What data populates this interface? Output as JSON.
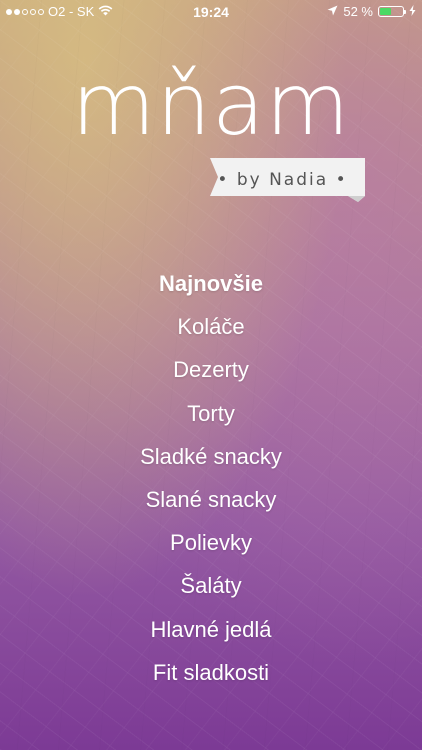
{
  "status_bar": {
    "carrier": "O2 - SK",
    "time": "19:24",
    "battery_percent": "52 %",
    "battery_level": 0.52,
    "signal_bars_filled": 2,
    "signal_bars_total": 5,
    "icons": [
      "wifi-icon",
      "location-arrow-icon",
      "battery-icon",
      "charging-bolt-icon"
    ]
  },
  "logo": {
    "title": "mňam",
    "subtitle": "• by Nadia •"
  },
  "menu": {
    "items": [
      {
        "label": "Najnovšie",
        "active": true
      },
      {
        "label": "Koláče",
        "active": false
      },
      {
        "label": "Dezerty",
        "active": false
      },
      {
        "label": "Torty",
        "active": false
      },
      {
        "label": "Sladké snacky",
        "active": false
      },
      {
        "label": "Slané snacky",
        "active": false
      },
      {
        "label": "Polievky",
        "active": false
      },
      {
        "label": "Šaláty",
        "active": false
      },
      {
        "label": "Hlavné jedlá",
        "active": false
      },
      {
        "label": "Fit sladkosti",
        "active": false
      }
    ]
  },
  "colors": {
    "battery_fill": "#4cd964",
    "ribbon": "#f2f2f2",
    "gradient_top": "#c7a57e",
    "gradient_bottom": "#7c3a95"
  }
}
